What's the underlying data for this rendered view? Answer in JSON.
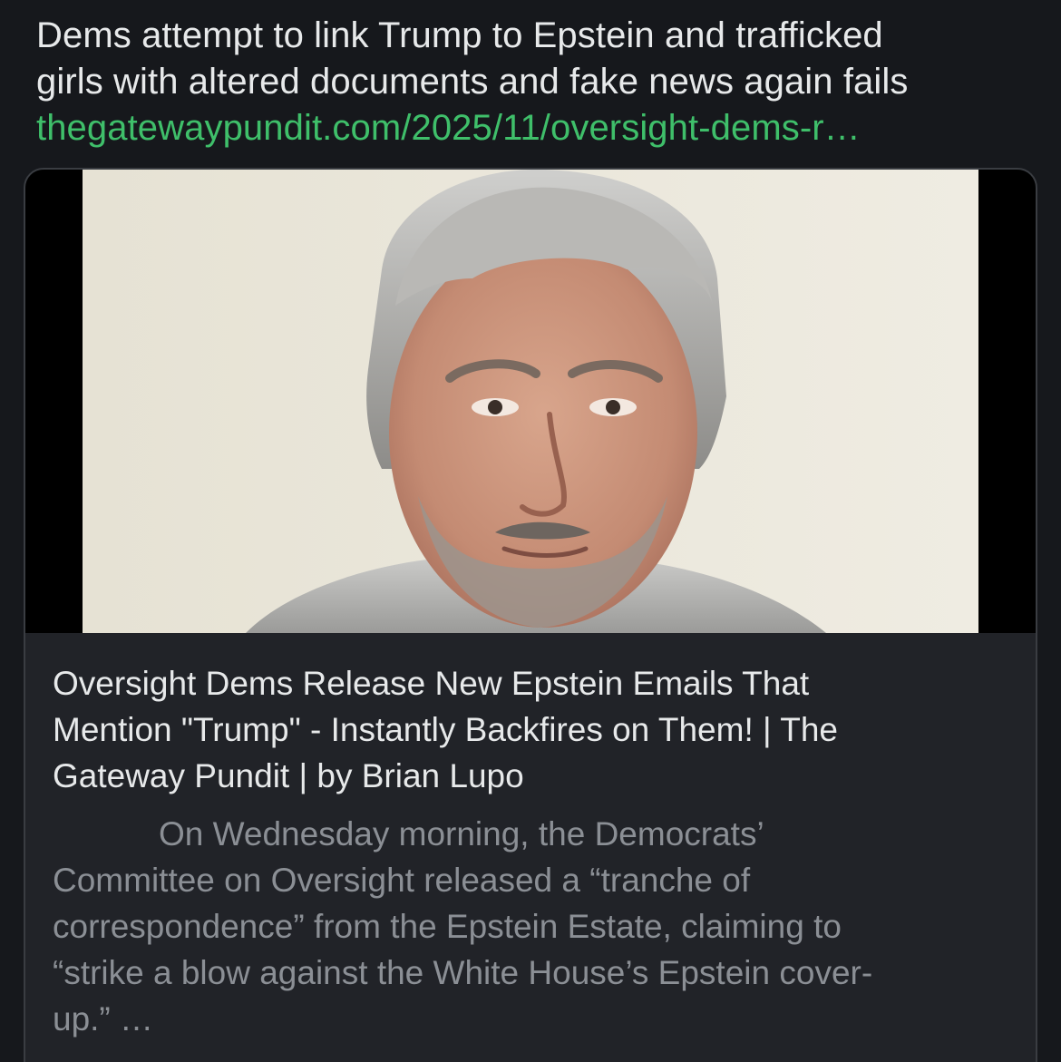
{
  "post": {
    "text_lines": [
      "Dems attempt to link Trump to Epstein and trafficked",
      "girls with altered documents and fake news again fails"
    ],
    "link": "thegatewaypundit.com/2025/11/oversight-dems-r…",
    "link_color": "#3fbf6a"
  },
  "card": {
    "image": "portrait-photo",
    "title_lines": [
      "Oversight Dems Release New Epstein Emails That",
      "Mention \"Trump\" - Instantly Backfires on Them! | The",
      "Gateway Pundit | by Brian Lupo"
    ],
    "description_lines": [
      "On Wednesday morning, the Democrats’",
      "Committee on Oversight released a “tranche of",
      "correspondence” from the Epstein Estate, claiming to",
      "“strike a blow against the White House’s Epstein cover-",
      "up.” …"
    ]
  },
  "colors": {
    "background": "#16181c",
    "card_background": "#212328",
    "text_primary": "#e7e9ea",
    "text_secondary": "#8b8f95"
  }
}
